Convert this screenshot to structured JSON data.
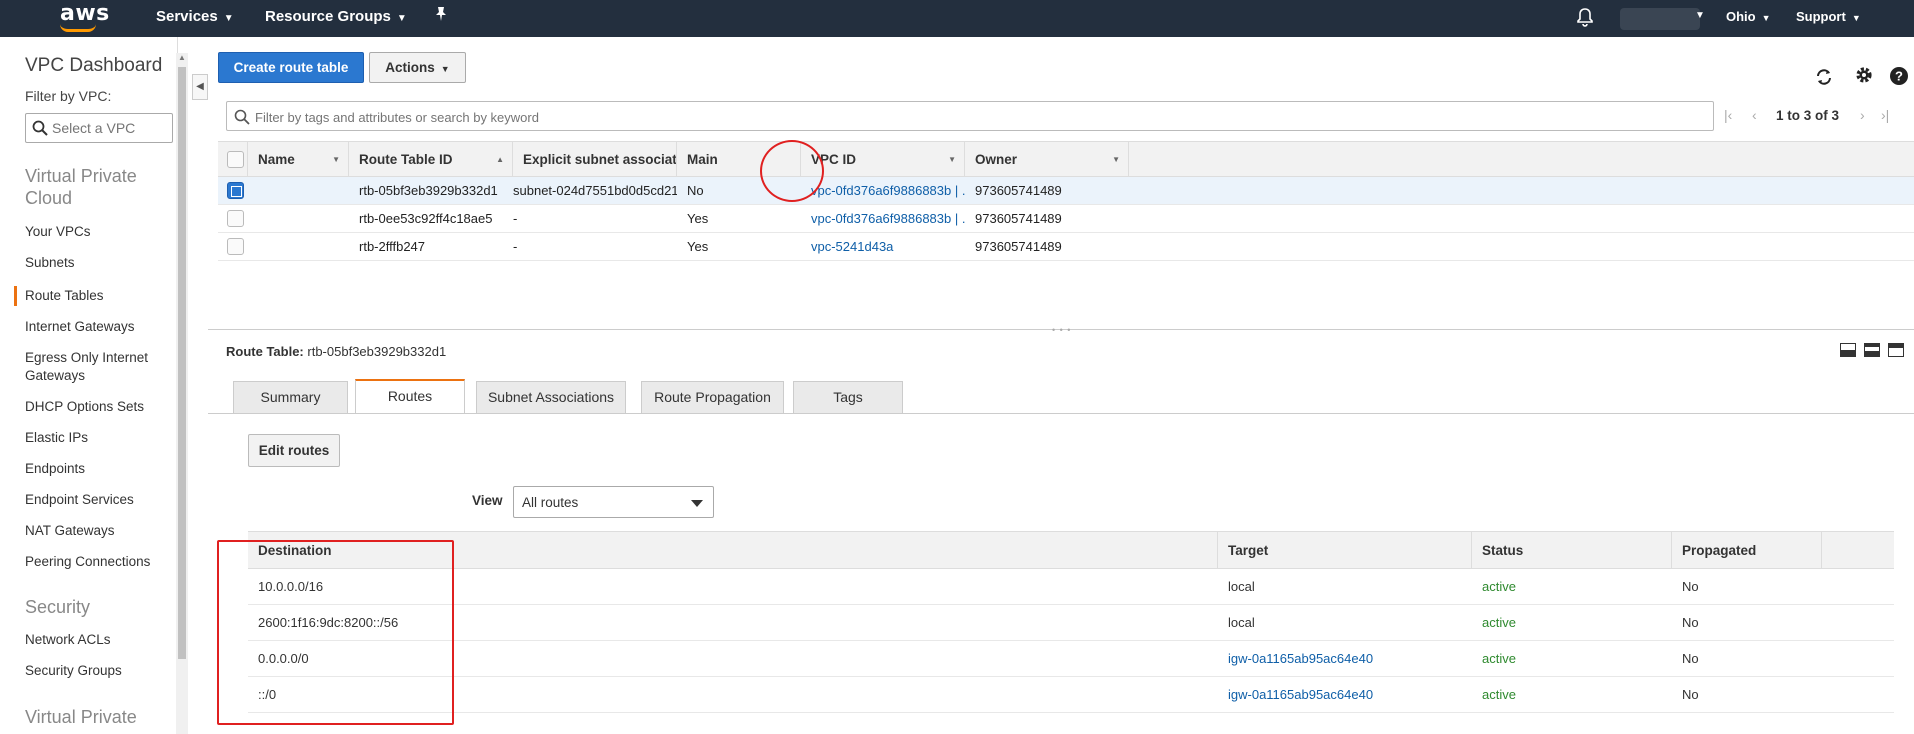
{
  "topbar": {
    "logo": "aws",
    "services": "Services",
    "resource_groups": "Resource Groups",
    "region": "Ohio",
    "support": "Support"
  },
  "sidebar": {
    "title": "VPC Dashboard",
    "filter_label": "Filter by VPC:",
    "filter_placeholder": "Select a VPC",
    "section_vpc": "Virtual Private Cloud",
    "items_vpc": [
      "Your VPCs",
      "Subnets",
      "Route Tables",
      "Internet Gateways",
      "Egress Only Internet Gateways",
      "DHCP Options Sets",
      "Elastic IPs",
      "Endpoints",
      "Endpoint Services",
      "NAT Gateways",
      "Peering Connections"
    ],
    "active_item": "Route Tables",
    "section_security": "Security",
    "items_security": [
      "Network ACLs",
      "Security Groups"
    ],
    "section_vpn": "Virtual Private"
  },
  "toolbar": {
    "create_label": "Create route table",
    "actions_label": "Actions"
  },
  "search": {
    "placeholder": "Filter by tags and attributes or search by keyword"
  },
  "pagination": {
    "text": "1 to 3 of 3"
  },
  "route_tables": {
    "columns": [
      "Name",
      "Route Table ID",
      "Explicit subnet association",
      "Main",
      "VPC ID",
      "Owner"
    ],
    "rows": [
      {
        "selected": true,
        "name": "",
        "id": "rtb-05bf3eb3929b332d1",
        "subnet": "subnet-024d7551bd0d5cd21",
        "main": "No",
        "vpc": "vpc-0fd376a6f9886883b | ...",
        "owner": "973605741489"
      },
      {
        "selected": false,
        "name": "",
        "id": "rtb-0ee53c92ff4c18ae5",
        "subnet": "-",
        "main": "Yes",
        "vpc": "vpc-0fd376a6f9886883b | ...",
        "owner": "973605741489"
      },
      {
        "selected": false,
        "name": "",
        "id": "rtb-2fffb247",
        "subnet": "-",
        "main": "Yes",
        "vpc": "vpc-5241d43a",
        "owner": "973605741489"
      }
    ]
  },
  "detail": {
    "label": "Route Table:",
    "id": "rtb-05bf3eb3929b332d1",
    "tabs": [
      "Summary",
      "Routes",
      "Subnet Associations",
      "Route Propagation",
      "Tags"
    ],
    "active_tab": "Routes",
    "edit_label": "Edit routes",
    "view_label": "View",
    "view_value": "All routes"
  },
  "routes": {
    "columns": [
      "Destination",
      "Target",
      "Status",
      "Propagated"
    ],
    "rows": [
      {
        "destination": "10.0.0.0/16",
        "target": "local",
        "target_link": false,
        "status": "active",
        "propagated": "No"
      },
      {
        "destination": "2600:1f16:9dc:8200::/56",
        "target": "local",
        "target_link": false,
        "status": "active",
        "propagated": "No"
      },
      {
        "destination": "0.0.0.0/0",
        "target": "igw-0a1165ab95ac64e40",
        "target_link": true,
        "status": "active",
        "propagated": "No"
      },
      {
        "destination": "::/0",
        "target": "igw-0a1165ab95ac64e40",
        "target_link": true,
        "status": "active",
        "propagated": "No"
      }
    ]
  },
  "colors": {
    "nav_bg": "#232f3e",
    "primary": "#2b78d0",
    "accent": "#ec7211",
    "link": "#0f5fa8",
    "status_active": "#2f8a2f",
    "annotation": "#e02020"
  }
}
